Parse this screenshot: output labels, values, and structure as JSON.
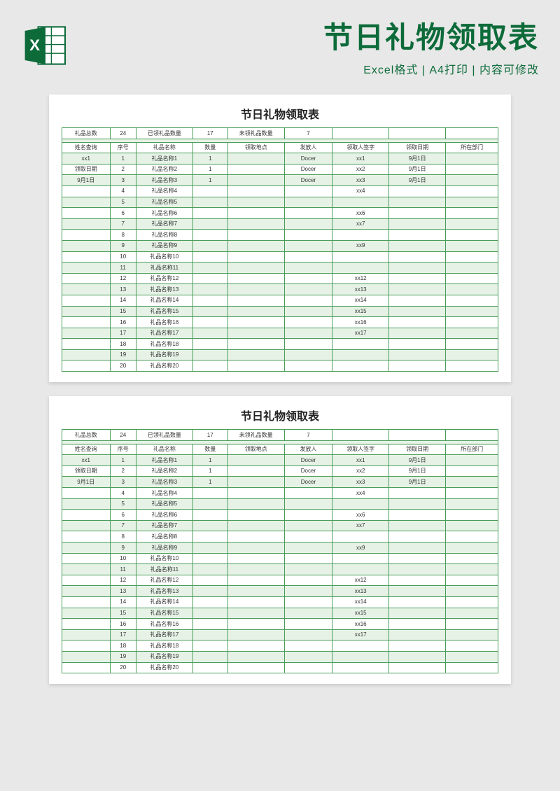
{
  "header": {
    "main_title": "节日礼物领取表",
    "sub_title": "Excel格式 | A4打印 | 内容可修改",
    "icon_text": "X"
  },
  "sheet": {
    "title": "节日礼物领取表",
    "summary": {
      "total_label": "礼品总数",
      "total_value": "24",
      "received_label": "已领礼品数量",
      "received_value": "17",
      "unreceived_label": "未领礼品数量",
      "unreceived_value": "7"
    },
    "query_labels": {
      "name_query": "姓名查询",
      "recv_name": "xx1",
      "recv_date_label": "领取日期",
      "recv_date_value": "9月1日"
    },
    "columns": [
      "序号",
      "礼品名称",
      "数量",
      "领取地点",
      "发放人",
      "领取人签字",
      "领取日期",
      "所在部门"
    ],
    "rows": [
      {
        "seq": "1",
        "name": "礼品名称1",
        "qty": "1",
        "loc": "",
        "issuer": "Docer",
        "signer": "xx1",
        "date": "9月1日",
        "dept": ""
      },
      {
        "seq": "2",
        "name": "礼品名称2",
        "qty": "1",
        "loc": "",
        "issuer": "Docer",
        "signer": "xx2",
        "date": "9月1日",
        "dept": ""
      },
      {
        "seq": "3",
        "name": "礼品名称3",
        "qty": "1",
        "loc": "",
        "issuer": "Docer",
        "signer": "xx3",
        "date": "9月1日",
        "dept": ""
      },
      {
        "seq": "4",
        "name": "礼品名称4",
        "qty": "",
        "loc": "",
        "issuer": "",
        "signer": "xx4",
        "date": "",
        "dept": ""
      },
      {
        "seq": "5",
        "name": "礼品名称5",
        "qty": "",
        "loc": "",
        "issuer": "",
        "signer": "",
        "date": "",
        "dept": ""
      },
      {
        "seq": "6",
        "name": "礼品名称6",
        "qty": "",
        "loc": "",
        "issuer": "",
        "signer": "xx6",
        "date": "",
        "dept": ""
      },
      {
        "seq": "7",
        "name": "礼品名称7",
        "qty": "",
        "loc": "",
        "issuer": "",
        "signer": "xx7",
        "date": "",
        "dept": ""
      },
      {
        "seq": "8",
        "name": "礼品名称8",
        "qty": "",
        "loc": "",
        "issuer": "",
        "signer": "",
        "date": "",
        "dept": ""
      },
      {
        "seq": "9",
        "name": "礼品名称9",
        "qty": "",
        "loc": "",
        "issuer": "",
        "signer": "xx9",
        "date": "",
        "dept": ""
      },
      {
        "seq": "10",
        "name": "礼品名称10",
        "qty": "",
        "loc": "",
        "issuer": "",
        "signer": "",
        "date": "",
        "dept": ""
      },
      {
        "seq": "11",
        "name": "礼品名称11",
        "qty": "",
        "loc": "",
        "issuer": "",
        "signer": "",
        "date": "",
        "dept": ""
      },
      {
        "seq": "12",
        "name": "礼品名称12",
        "qty": "",
        "loc": "",
        "issuer": "",
        "signer": "xx12",
        "date": "",
        "dept": ""
      },
      {
        "seq": "13",
        "name": "礼品名称13",
        "qty": "",
        "loc": "",
        "issuer": "",
        "signer": "xx13",
        "date": "",
        "dept": ""
      },
      {
        "seq": "14",
        "name": "礼品名称14",
        "qty": "",
        "loc": "",
        "issuer": "",
        "signer": "xx14",
        "date": "",
        "dept": ""
      },
      {
        "seq": "15",
        "name": "礼品名称15",
        "qty": "",
        "loc": "",
        "issuer": "",
        "signer": "xx15",
        "date": "",
        "dept": ""
      },
      {
        "seq": "16",
        "name": "礼品名称16",
        "qty": "",
        "loc": "",
        "issuer": "",
        "signer": "xx16",
        "date": "",
        "dept": ""
      },
      {
        "seq": "17",
        "name": "礼品名称17",
        "qty": "",
        "loc": "",
        "issuer": "",
        "signer": "xx17",
        "date": "",
        "dept": ""
      },
      {
        "seq": "18",
        "name": "礼品名称18",
        "qty": "",
        "loc": "",
        "issuer": "",
        "signer": "",
        "date": "",
        "dept": ""
      },
      {
        "seq": "19",
        "name": "礼品名称19",
        "qty": "",
        "loc": "",
        "issuer": "",
        "signer": "",
        "date": "",
        "dept": ""
      },
      {
        "seq": "20",
        "name": "礼品名称20",
        "qty": "",
        "loc": "",
        "issuer": "",
        "signer": "",
        "date": "",
        "dept": ""
      }
    ]
  },
  "colors": {
    "brand_green": "#0d6b3a",
    "border_green": "#4a9d5a",
    "alt_row": "#e6f2e6"
  }
}
